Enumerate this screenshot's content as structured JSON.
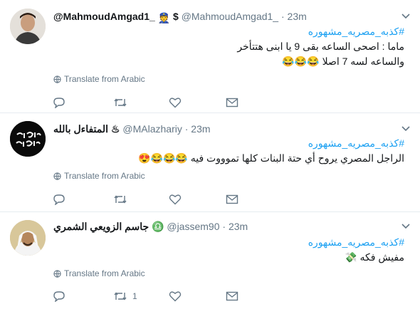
{
  "tweets": [
    {
      "name": "@MahmoudAmgad1_",
      "name_emoji": "👮",
      "badge": "$",
      "handle": "@MahmoudAmgad1_",
      "dot": "·",
      "time": "23m",
      "hashtag": "#كذبه_مصريه_مشهوره",
      "lines": [
        "ماما : اصحى الساعه بقى 9 يا ابنى هتتأخر",
        "والساعه لسه 7 اصلا 😂😂😂"
      ],
      "translate": "Translate from Arabic",
      "retweet_count": "",
      "like_count": ""
    },
    {
      "name": "المتفاءل بالله ♨",
      "handle": "@MAlazhariy",
      "dot": "·",
      "time": "23m",
      "hashtag": "#كذبه_مصريه_مشهوره",
      "lines": [
        "الراجل المصري يروح أي حتة البنات كلها تموووت فيه 😂😂😂😍"
      ],
      "translate": "Translate from Arabic",
      "retweet_count": "",
      "like_count": ""
    },
    {
      "name": "جاسم الزويعي الشمري ♎",
      "handle": "@jassem90",
      "dot": "·",
      "time": "23m",
      "hashtag": "#كذبه_مصريه_مشهوره",
      "lines": [
        "مفيش فكه 💸"
      ],
      "translate": "Translate from Arabic",
      "retweet_count": "1",
      "like_count": ""
    }
  ],
  "icons": {
    "reply": "reply-icon",
    "retweet": "retweet-icon",
    "like": "heart-icon",
    "message": "envelope-icon",
    "translate": "globe-icon",
    "caret": "chevron-down-icon"
  },
  "colors": {
    "hashtag": "#1da1f2",
    "secondary": "#657786",
    "divider": "#e6ecf0"
  }
}
